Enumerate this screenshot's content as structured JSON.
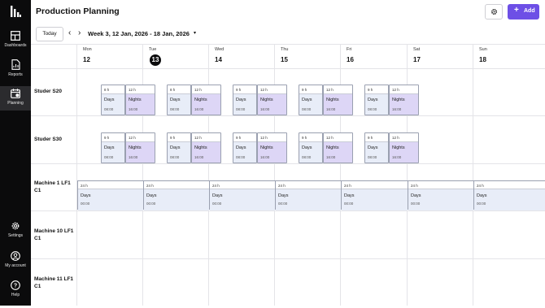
{
  "app": {
    "title": "Production Planning",
    "add_label": "Add"
  },
  "sidebar": {
    "items": [
      {
        "label": "Dashboards",
        "icon": "dashboard-icon"
      },
      {
        "label": "Reports",
        "icon": "report-icon"
      },
      {
        "label": "Planning",
        "icon": "calendar-icon",
        "active": true
      },
      {
        "label": "Settings",
        "icon": "gear-icon"
      },
      {
        "label": "My account",
        "icon": "user-icon"
      },
      {
        "label": "Help",
        "icon": "help-icon"
      }
    ]
  },
  "toolbar": {
    "today_label": "Today",
    "week_label": "Week 3, 12 Jan, 2026 - 18 Jan, 2026"
  },
  "days": [
    {
      "name": "Mon",
      "num": "12"
    },
    {
      "name": "Tue",
      "num": "13",
      "today": true
    },
    {
      "name": "Wed",
      "num": "14"
    },
    {
      "name": "Thu",
      "num": "15"
    },
    {
      "name": "Fri",
      "num": "16"
    },
    {
      "name": "Sat",
      "num": "17"
    },
    {
      "name": "Sun",
      "num": "18"
    }
  ],
  "rows": [
    {
      "label": "Studer S20"
    },
    {
      "label": "Studer S30"
    },
    {
      "label": "Machine 1 LF1 C1"
    },
    {
      "label": "Machine 10 LF1 C1"
    },
    {
      "label": "Machine 11 LF1 C1"
    }
  ],
  "shifts": {
    "day": {
      "hours": "8 h",
      "name": "Days",
      "time": "08:00"
    },
    "day9": {
      "hours": "9 h",
      "name": "Days",
      "time": "08:00"
    },
    "night": {
      "hours": "12 h",
      "name": "Nights",
      "time": "16:00"
    },
    "full": {
      "hours": "24 h",
      "name": "Days",
      "time": "00:00"
    }
  },
  "schedule": {
    "studer_s20": [
      "day",
      "day",
      "day9",
      "day9",
      "day9"
    ],
    "studer_s30": [
      "day9",
      "day9",
      "day9",
      "day9",
      "day9"
    ],
    "machine1_days": 7
  },
  "colors": {
    "accent": "#6d4fe6",
    "day_fill": "#e8edf8",
    "night_fill": "#ddd6f6",
    "sidebar": "#0b0b0c"
  }
}
